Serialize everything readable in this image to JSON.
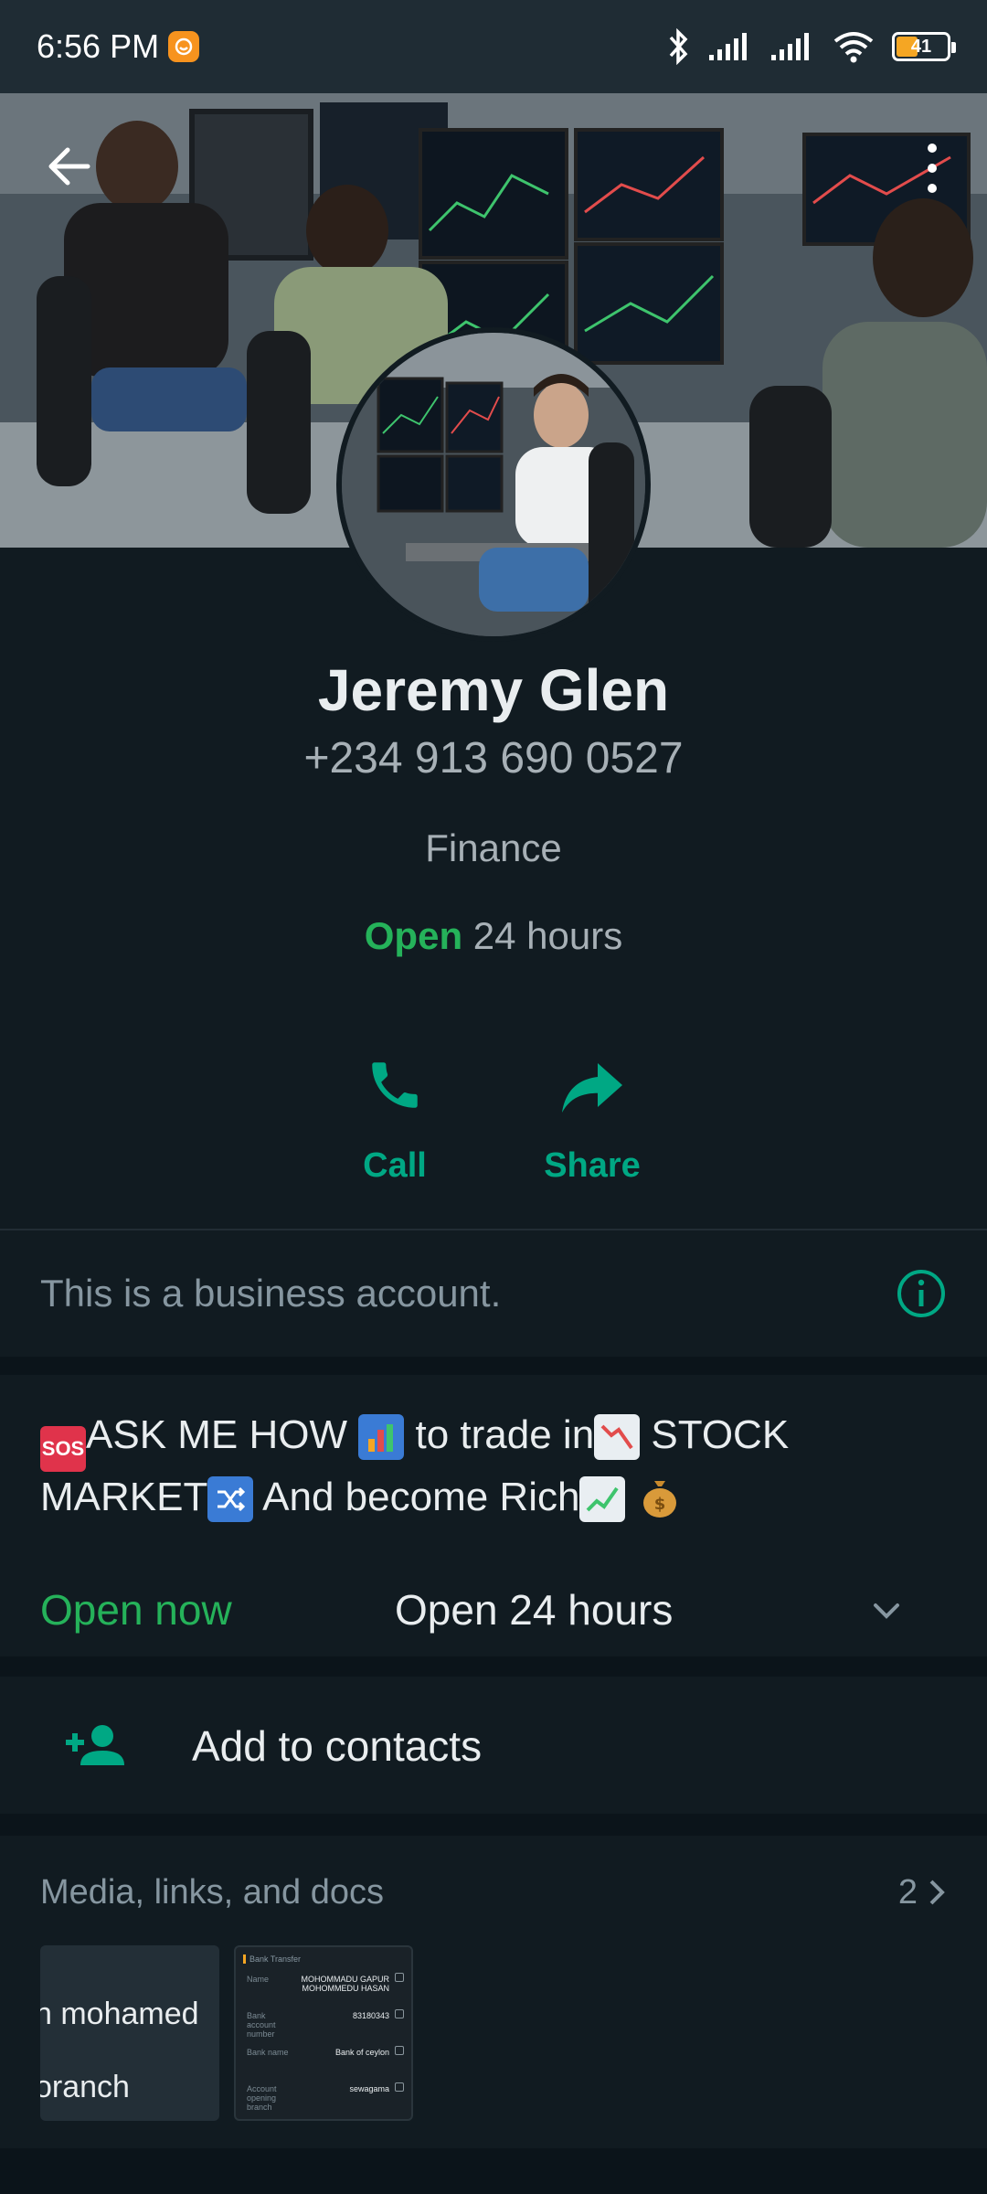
{
  "status_bar": {
    "time": "6:56 PM",
    "battery": "41",
    "icons": [
      "bluetooth-icon",
      "signal-icon",
      "signal-icon",
      "wifi-icon",
      "battery-icon"
    ]
  },
  "profile": {
    "name": "Jeremy Glen",
    "phone": "+234 913 690 0527",
    "category": "Finance",
    "hours_status": "Open",
    "hours_detail": " 24 hours"
  },
  "actions": [
    {
      "label": "Call",
      "icon": "phone-icon"
    },
    {
      "label": "Share",
      "icon": "share-icon"
    }
  ],
  "business_note": "This is a business account.",
  "description": {
    "part1": "ASK ME HOW",
    "part2": " to trade in",
    "part3": " STOCK MARKET",
    "part4": " And become Rich",
    "sos": "SOS"
  },
  "hours": {
    "status": "Open now",
    "value": "Open 24 hours"
  },
  "add_contact": {
    "label": "Add to contacts"
  },
  "media": {
    "title": "Media, links, and docs",
    "count": "2",
    "thumb1_line1": "n mohamed",
    "thumb1_line2": "oranch",
    "thumb2": {
      "title": "Bank Transfer",
      "rows": [
        {
          "k": "Name",
          "v": "MOHOMMADU GAPUR MOHOMMEDU HASAN"
        },
        {
          "k": "Bank account number",
          "v": "83180343"
        },
        {
          "k": "Bank name",
          "v": "Bank of ceylon"
        },
        {
          "k": "Account opening branch",
          "v": "sewagama"
        }
      ]
    }
  },
  "colors": {
    "accent": "#00a884",
    "open_green": "#25b25a",
    "background": "#111b21",
    "muted_text": "#8696a0"
  }
}
